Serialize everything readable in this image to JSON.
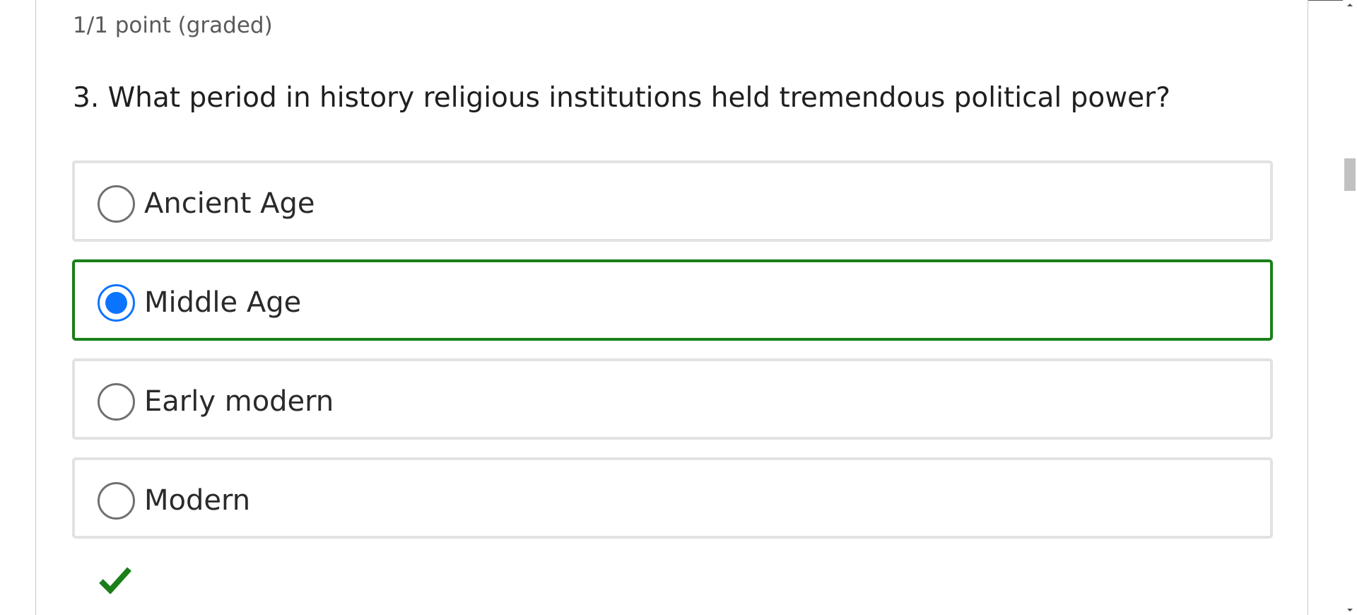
{
  "problem": {
    "points": "1/1 point (graded)",
    "question": "3. What period in history religious institutions held tremendous political power?",
    "options": [
      {
        "label": "Ancient Age",
        "selected": false
      },
      {
        "label": "Middle Age",
        "selected": true
      },
      {
        "label": "Early modern",
        "selected": false
      },
      {
        "label": "Modern",
        "selected": false
      }
    ],
    "result_icon": "checkmark-icon"
  },
  "colors": {
    "correct_border": "#1a7f1a",
    "radio_selected": "#0b74ff",
    "checkmark": "#1a7f1a"
  }
}
